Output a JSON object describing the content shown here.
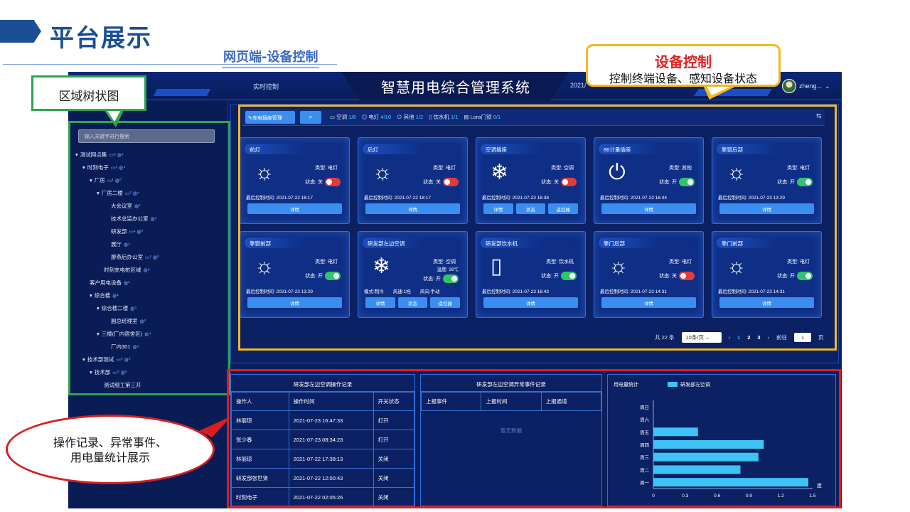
{
  "slide": {
    "title": "平台展示",
    "subtitle": "网页端-设备控制"
  },
  "header": {
    "system_title": "智慧用电综合管理系统",
    "nav_realtime": "实时控制",
    "date": "2021/",
    "user": "zheng...",
    "user_chevron": "⌄"
  },
  "tree": {
    "search_placeholder": "输入关键字进行搜索",
    "items": [
      {
        "label": "测试网点集",
        "badge": "▭⁸ ◍⁴"
      },
      {
        "label": "时刻电子",
        "badge": "▭⁸ ◍⁴"
      },
      {
        "label": "厂房",
        "badge": "▭¹ ◍⁰"
      },
      {
        "label": "厂房二楼",
        "badge": "▭² ◍⁴"
      },
      {
        "label": "大会议室",
        "badge": "◍¹"
      },
      {
        "label": "技术总监办公室",
        "badge": "◍⁴"
      },
      {
        "label": "研发部",
        "badge": "▭¹ ◍⁰"
      },
      {
        "label": "展厅",
        "badge": "◍¹"
      },
      {
        "label": "廖燕后办公室",
        "badge": "▭¹ ◍⁰"
      },
      {
        "label": "时刻充电桩区域",
        "badge": "◍⁸"
      },
      {
        "label": "客户用电设备",
        "badge": "◍¹"
      },
      {
        "label": "综合楼",
        "badge": "◍¹"
      },
      {
        "label": "综合楼二楼",
        "badge": "◍⁰"
      },
      {
        "label": "副总经理室",
        "badge": "◍⁰"
      },
      {
        "label": "三楼(厂内宿舍区)",
        "badge": "◍⁴"
      },
      {
        "label": "厂内301",
        "badge": "◍⁴"
      },
      {
        "label": "技术部测试",
        "badge": "▭⁰ ◍⁰"
      },
      {
        "label": "技术部",
        "badge": "▭⁰ ◍⁰"
      },
      {
        "label": "测试细工第三开",
        "badge": ""
      }
    ]
  },
  "toolbar": {
    "filter_label": "✎充电插座管理",
    "search_icon": "⌕",
    "counts": [
      {
        "icon": "▭",
        "label": "空调",
        "num": "1/8"
      },
      {
        "icon": "◎",
        "label": "电灯",
        "num": "4/10"
      },
      {
        "icon": "⊙",
        "label": "其他",
        "num": "1/2"
      },
      {
        "icon": "▯",
        "label": "饮水机",
        "num": "1/1"
      },
      {
        "icon": "▤",
        "label": "Lora门锁",
        "num": "0/1"
      }
    ],
    "expand_icon": "⇆"
  },
  "cards": [
    {
      "name": "前灯",
      "icon": "☼",
      "type": "类型: 电灯",
      "state": "状态: 关",
      "on": false,
      "time": "最后控制时间: 2021-07-22 18:17",
      "buttons": [
        "详情"
      ],
      "extra": ""
    },
    {
      "name": "后灯",
      "icon": "☼",
      "type": "类型: 电灯",
      "state": "状态: 关",
      "on": false,
      "time": "最后控制时间: 2021-07-22 18:17",
      "buttons": [
        "详情"
      ],
      "extra": ""
    },
    {
      "name": "空调插座",
      "icon": "❄",
      "type": "类型: 空调",
      "state": "状态: 关",
      "on": false,
      "time": "最后控制时间: 2021-07-23 16:38",
      "buttons": [
        "详情",
        "状态",
        "遥控器"
      ],
      "extra": ""
    },
    {
      "name": "86计量插座",
      "icon": "⏻",
      "type": "类型: 其他",
      "state": "状态: 开",
      "on": true,
      "time": "最后控制时间: 2021-07-23 16:44",
      "buttons": [
        "详情"
      ],
      "extra": ""
    },
    {
      "name": "靠窗后部",
      "icon": "☼",
      "type": "类型: 电灯",
      "state": "状态: 开",
      "on": true,
      "time": "最后控制时间: 2021-07-23 13:29",
      "buttons": [
        "详情"
      ],
      "extra": ""
    },
    {
      "name": "靠窗前部",
      "icon": "☼",
      "type": "类型: 电灯",
      "state": "状态: 开",
      "on": true,
      "time": "最后控制时间: 2021-07-23 13:29",
      "buttons": [
        "详情"
      ],
      "extra": ""
    },
    {
      "name": "研发部左边空调",
      "icon": "❄",
      "type": "类型: 空调",
      "state": "状态: 开",
      "on": true,
      "time": "模式:制冷　　风速:1档　　风向:手动",
      "buttons": [
        "详情",
        "状态",
        "遥控器"
      ],
      "extra": "温度: 26℃"
    },
    {
      "name": "研发部饮水机",
      "icon": "▯",
      "type": "类型: 饮水机",
      "state": "状态: 开",
      "on": true,
      "time": "最后控制时间: 2021-07-23 16:43",
      "buttons": [
        "详情"
      ],
      "extra": ""
    },
    {
      "name": "靠门后部",
      "icon": "☼",
      "type": "类型: 电灯",
      "state": "状态: 关",
      "on": false,
      "time": "最后控制时间: 2021-07-23 14:31",
      "buttons": [
        "详情"
      ],
      "extra": ""
    },
    {
      "name": "靠门前部",
      "icon": "☼",
      "type": "类型: 电灯",
      "state": "状态: 开",
      "on": true,
      "time": "最后控制时间: 2021-07-23 14:31",
      "buttons": [
        "详情"
      ],
      "extra": ""
    }
  ],
  "pager": {
    "total": "共 22 条",
    "page_size": "10条/页 ⌄",
    "prev": "‹",
    "pages": [
      "1",
      "2",
      "3"
    ],
    "next": "›",
    "goto_label": "前往",
    "goto_value": "1",
    "goto_unit": "页"
  },
  "op_records": {
    "title": "研发部左边空调操作记录",
    "columns": [
      "操作人",
      "操作时间",
      "开关状态"
    ],
    "rows": [
      [
        "林丽琼",
        "2021-07-23 16:47:33",
        "打开"
      ],
      [
        "张少春",
        "2021-07-23 08:34:23",
        "打开"
      ],
      [
        "林丽琼",
        "2021-07-22 17:38:13",
        "关闭"
      ],
      [
        "研发部张世贤",
        "2021-07-22 12:00:43",
        "关闭"
      ],
      [
        "时刻电子",
        "2021-07-22 02:05:26",
        "关闭"
      ]
    ]
  },
  "abnormal": {
    "title": "研发部左边空调异常事件记录",
    "columns": [
      "上报事件",
      "上报时间",
      "上报通道"
    ],
    "empty": "暂无数据"
  },
  "chart_data": {
    "type": "bar",
    "title": "用电量统计",
    "legend": "研发部左空调",
    "unit": "度",
    "categories": [
      "周日",
      "周六",
      "周五",
      "周四",
      "周三",
      "周二",
      "周一"
    ],
    "values": [
      0,
      0,
      0.42,
      1.04,
      0.99,
      0.82,
      1.46
    ],
    "xticks": [
      "0",
      "0.3",
      "0.6",
      "0.9",
      "1.2",
      "1.5"
    ],
    "xlim": [
      0,
      1.5
    ],
    "bar_color": "#3ec3f5"
  },
  "annotations": {
    "tree": "区域树状图",
    "control_title": "设备控制",
    "control_desc": "控制终端设备、感知设备状态",
    "records_line1": "操作记录、异常事件、",
    "records_line2": "用电量统计展示"
  }
}
